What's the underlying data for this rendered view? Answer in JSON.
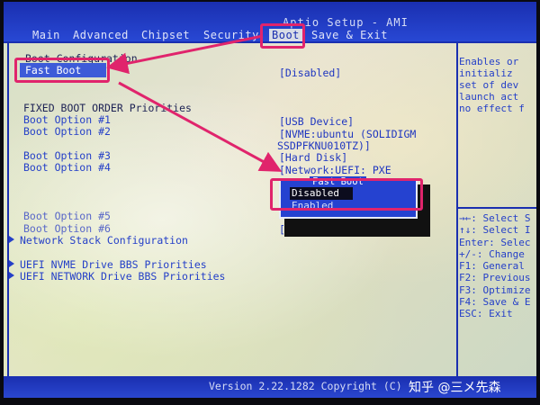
{
  "header": {
    "title": "Aptio Setup - AMI"
  },
  "menu_tabs": [
    "Main",
    "Advanced",
    "Chipset",
    "Security",
    "Boot",
    "Save & Exit"
  ],
  "active_tab": "Boot",
  "left_panel": {
    "boot_configuration": "Boot Configuration",
    "fast_boot": "Fast Boot",
    "fixed_boot_order": "FIXED BOOT ORDER Priorities",
    "boot_options": [
      {
        "label": "Boot Option #1",
        "value": "[USB Device]"
      },
      {
        "label": "Boot Option #2",
        "value": "[NVME:ubuntu (SOLIDIGM",
        "value2": "SSDPFKNU010TZ)]"
      },
      {
        "label": "Boot Option #3",
        "value": "[Hard Disk]"
      },
      {
        "label": "Boot Option #4",
        "value": "[Network:UEFI: PXE"
      },
      {
        "label": "Boot Option #5",
        "value": ""
      },
      {
        "label": "Boot Option #6",
        "value": "[S"
      }
    ],
    "network_stack": "Network Stack Configuration",
    "uefi_nvme": "UEFI NVME Drive BBS Priorities",
    "uefi_network": "UEFI NETWORK Drive BBS Priorities"
  },
  "values": {
    "fast_boot": "[Disabled]"
  },
  "popup": {
    "title": "Fast Boot",
    "options": [
      "Disabled",
      "Enabled"
    ],
    "selected": "Disabled"
  },
  "help_top": [
    "Enables or",
    "initializ",
    "set of dev",
    "launch act",
    "no effect f"
  ],
  "help_keys": [
    "→←: Select S",
    "↑↓: Select I",
    "Enter: Selec",
    "+/-: Change",
    "F1: General",
    "F2: Previous",
    "F3: Optimize",
    "F4: Save & E",
    "ESC: Exit"
  ],
  "footer": {
    "version": "Version 2.22.1282 Copyright (C)"
  },
  "watermark": "知乎 @三メ先森",
  "colors": {
    "bios_blue": "#1a2fb0",
    "annotation_pink": "#e0246c",
    "highlight": "#3d5bd8"
  }
}
